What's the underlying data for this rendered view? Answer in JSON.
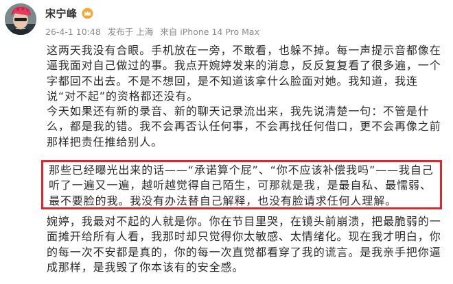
{
  "post": {
    "author": {
      "name": "宋宁峰",
      "badge_icon": "crown-badge-icon",
      "badge_color": "#f2a93b"
    },
    "meta": {
      "timestamp": "26-4-1 10:48",
      "location": "发布于 上海",
      "device": "来自 iPhone 14 Pro Max"
    },
    "paragraphs": {
      "p1": "这两天我没有合眼。手机放在一旁，不敢看，也躲不掉。每一声提示音都像在逼我面对自己做过的事。我点开婉婷发来的消息，反反复复看了很多遍，一个字都回不出去。不是不想回，是不知道该拿什么脸面对她。我知道，我连说“对不起”的资格都还没有。",
      "p2": "今天如果还有新的录音、新的聊天记录流出来，我先说清楚一句：不管是什么，都是我的错。我不会再否认任何事，不会再找任何借口，更不会再像之前那样把责任推给别人。",
      "p3": "那些已经曝光出来的话——“承诺算个屁”、“你不应该补偿我吗”——我自己听了一遍又一遍，越听越觉得自己陌生，可那就是我，是最自私、最懦弱、最不要脸的我。我没有办法替自己解释，也没有脸请求任何人理解。",
      "p4": "婉婷，我最对不起的人就是你。你在节目里哭，在镜头前崩溃，把最脆弱的一面摊开给所有人看，我那时却只觉得你太敏感、太情绪化。现在我才明白，你的每一次不安都是真的，你的每一次直觉都看穿了我的谎言。是我亲手把你逼成那样，是我毁了你本该有的安全感。"
    },
    "highlight_color": "#e0262c"
  }
}
